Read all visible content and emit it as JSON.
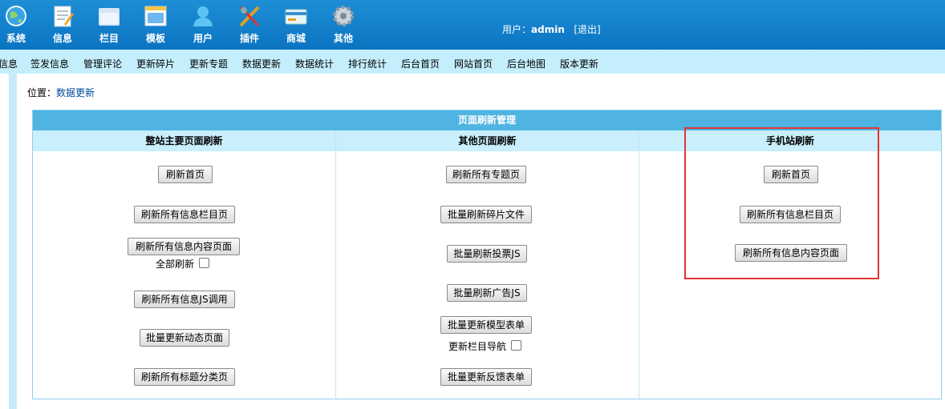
{
  "topnav": [
    {
      "label": "系统",
      "icon": "globe-icon"
    },
    {
      "label": "信息",
      "icon": "notepad-icon"
    },
    {
      "label": "栏目",
      "icon": "folder-icon"
    },
    {
      "label": "模板",
      "icon": "window-icon"
    },
    {
      "label": "用户",
      "icon": "user-icon"
    },
    {
      "label": "插件",
      "icon": "tools-icon"
    },
    {
      "label": "商城",
      "icon": "card-icon"
    },
    {
      "label": "其他",
      "icon": "gear-icon"
    }
  ],
  "user": {
    "prefix": "用户：",
    "name": "admin",
    "logout": "[退出]"
  },
  "menu": [
    "信息",
    "签发信息",
    "管理评论",
    "更新碎片",
    "更新专题",
    "数据更新",
    "数据统计",
    "排行统计",
    "后台首页",
    "网站首页",
    "后台地图",
    "版本更新"
  ],
  "breadcrumb": {
    "prefix": "位置：",
    "link": "数据更新"
  },
  "panel": {
    "title": "页面刷新管理",
    "col1": {
      "header": "整站主要页面刷新",
      "buttons": [
        "刷新首页",
        "刷新所有信息栏目页",
        "刷新所有信息内容页面",
        "刷新所有信息JS调用",
        "批量更新动态页面",
        "刷新所有标题分类页"
      ],
      "checkbox": "全部刷新"
    },
    "col2": {
      "header": "其他页面刷新",
      "buttons": [
        "刷新所有专题页",
        "批量刷新碎片文件",
        "批量刷新投票JS",
        "批量刷新广告JS",
        "批量更新模型表单",
        "批量更新反馈表单"
      ],
      "checkbox": "更新栏目导航"
    },
    "col3": {
      "header": "手机站刷新",
      "buttons": [
        "刷新首页",
        "刷新所有信息栏目页",
        "刷新所有信息内容页面"
      ]
    }
  },
  "colors": {
    "topbar": "#0b74c2",
    "menubar": "#c4eefc",
    "panel_head": "#4fb4e2",
    "highlight": "#e23333"
  }
}
